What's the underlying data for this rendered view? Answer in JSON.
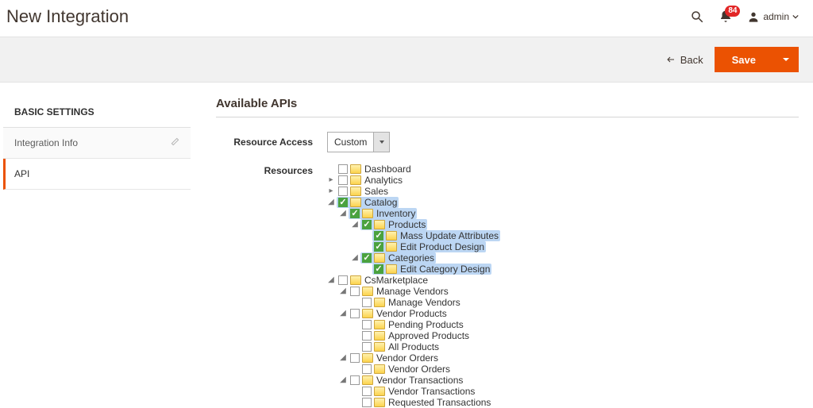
{
  "header": {
    "title": "New Integration",
    "notif_count": "84",
    "user_label": "admin"
  },
  "actions": {
    "back": "Back",
    "save": "Save"
  },
  "sidebar": {
    "title": "BASIC SETTINGS",
    "items": [
      {
        "label": "Integration Info",
        "active": false
      },
      {
        "label": "API",
        "active": true
      }
    ]
  },
  "main": {
    "section_title": "Available APIs",
    "resource_access_label": "Resource Access",
    "resource_access_value": "Custom",
    "resources_label": "Resources"
  },
  "tree": [
    {
      "label": "Dashboard",
      "checked": false
    },
    {
      "label": "Analytics",
      "checked": false,
      "hasChildren": true,
      "expanded": false
    },
    {
      "label": "Sales",
      "checked": false,
      "hasChildren": true,
      "expanded": false
    },
    {
      "label": "Catalog",
      "checked": true,
      "selected": true,
      "hasChildren": true,
      "expanded": true,
      "children": [
        {
          "label": "Inventory",
          "checked": true,
          "selected": true,
          "hasChildren": true,
          "expanded": true,
          "children": [
            {
              "label": "Products",
              "checked": true,
              "selected": true,
              "hasChildren": true,
              "expanded": true,
              "children": [
                {
                  "label": "Mass Update Attributes",
                  "checked": true,
                  "selected": true
                },
                {
                  "label": "Edit Product Design",
                  "checked": true,
                  "selected": true
                }
              ]
            },
            {
              "label": "Categories",
              "checked": true,
              "selected": true,
              "hasChildren": true,
              "expanded": true,
              "children": [
                {
                  "label": "Edit Category Design",
                  "checked": true,
                  "selected": true
                }
              ]
            }
          ]
        }
      ]
    },
    {
      "label": "CsMarketplace",
      "checked": false,
      "hasChildren": true,
      "expanded": true,
      "children": [
        {
          "label": "Manage Vendors",
          "checked": false,
          "hasChildren": true,
          "expanded": true,
          "children": [
            {
              "label": "Manage Vendors",
              "checked": false
            }
          ]
        },
        {
          "label": "Vendor Products",
          "checked": false,
          "hasChildren": true,
          "expanded": true,
          "children": [
            {
              "label": "Pending Products",
              "checked": false
            },
            {
              "label": "Approved Products",
              "checked": false
            },
            {
              "label": "All Products",
              "checked": false
            }
          ]
        },
        {
          "label": "Vendor Orders",
          "checked": false,
          "hasChildren": true,
          "expanded": true,
          "children": [
            {
              "label": "Vendor Orders",
              "checked": false
            }
          ]
        },
        {
          "label": "Vendor Transactions",
          "checked": false,
          "hasChildren": true,
          "expanded": true,
          "children": [
            {
              "label": "Vendor Transactions",
              "checked": false
            },
            {
              "label": "Requested Transactions",
              "checked": false
            }
          ]
        }
      ]
    }
  ]
}
